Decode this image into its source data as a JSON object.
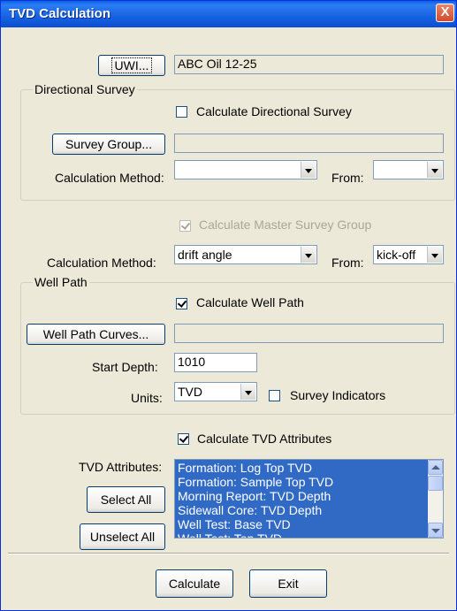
{
  "window": {
    "title": "TVD Calculation",
    "close": "X"
  },
  "uwi": {
    "button": "UWI...",
    "value": "ABC Oil 12-25"
  },
  "directional_survey": {
    "group_label": "Directional Survey",
    "checkbox_label": "Calculate Directional Survey",
    "checked": false,
    "survey_group_button": "Survey Group...",
    "survey_group_value": "",
    "calc_method_label": "Calculation Method:",
    "calc_method_value": "",
    "from_label": "From:",
    "from_value": ""
  },
  "master_survey": {
    "checkbox_label": "Calculate Master Survey Group",
    "checked": true,
    "enabled": false,
    "calc_method_label": "Calculation Method:",
    "calc_method_value": "drift angle",
    "from_label": "From:",
    "from_value": "kick-off"
  },
  "well_path": {
    "group_label": "Well Path",
    "checkbox_label": "Calculate Well Path",
    "checked": true,
    "curves_button": "Well Path Curves...",
    "curves_value": "",
    "start_depth_label": "Start Depth:",
    "start_depth_value": "1010",
    "units_label": "Units:",
    "units_value": "TVD",
    "survey_indicators_label": "Survey Indicators",
    "survey_indicators_checked": false
  },
  "tvd_attributes": {
    "checkbox_label": "Calculate TVD Attributes",
    "checked": true,
    "list_label": "TVD Attributes:",
    "select_all": "Select All",
    "unselect_all": "Unselect All",
    "items": [
      "Formation: Log Top TVD",
      "Formation: Sample Top TVD",
      "Morning Report: TVD Depth",
      "Sidewall Core: TVD Depth",
      "Well Test: Base TVD",
      "Well Test: Top TVD"
    ]
  },
  "footer": {
    "calculate": "Calculate",
    "exit": "Exit"
  }
}
